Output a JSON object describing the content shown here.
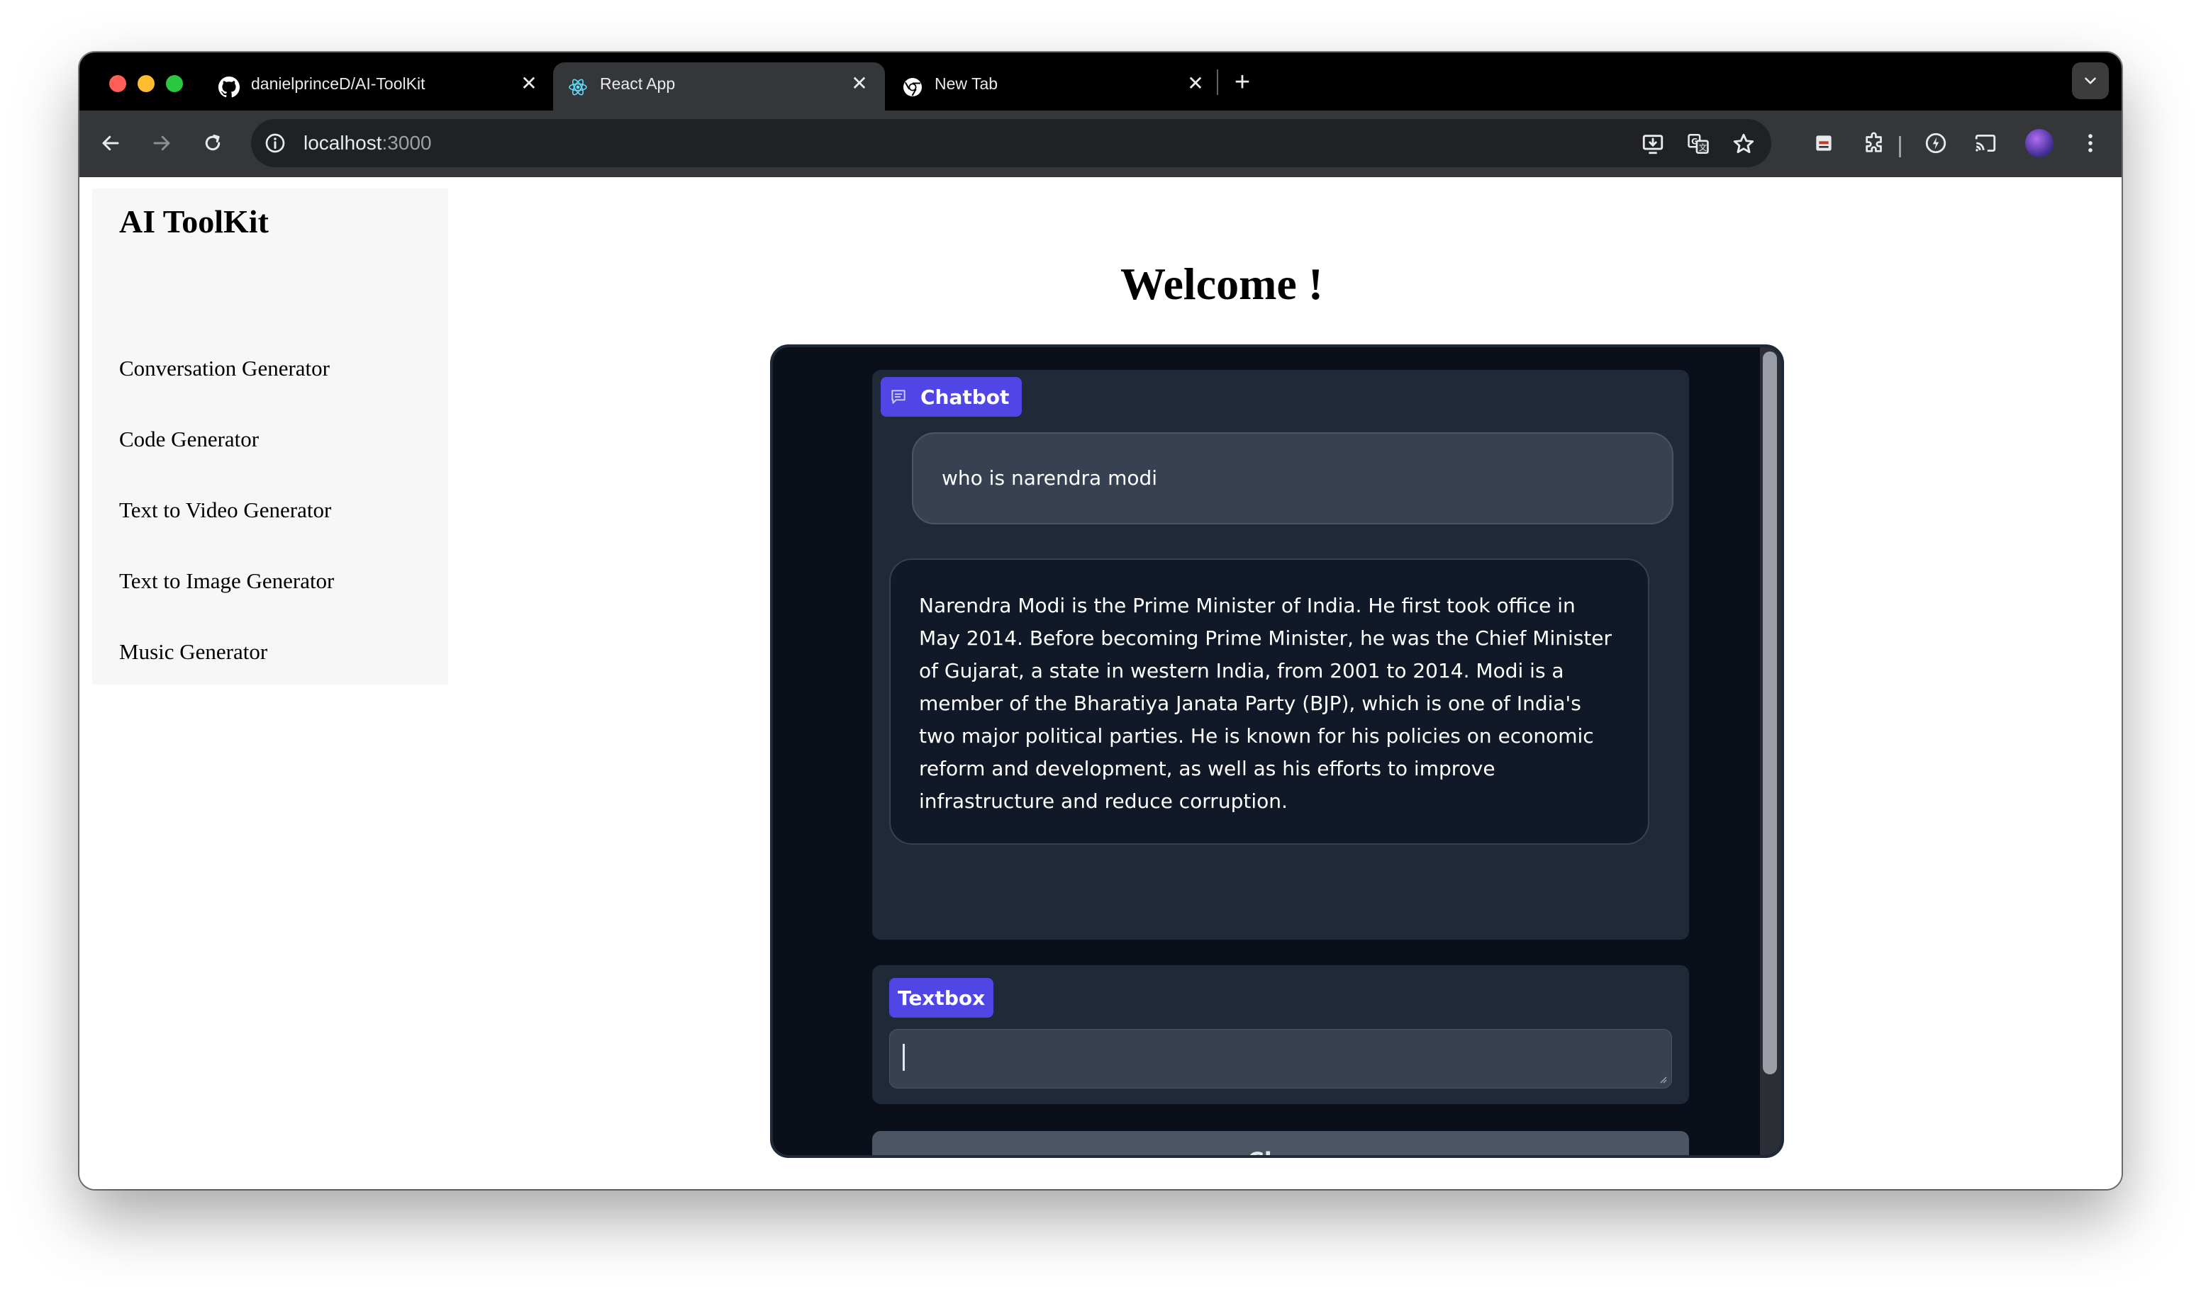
{
  "browser": {
    "tabs": [
      {
        "title": "danielprinceD/AI-ToolKit",
        "favicon": "github-icon",
        "active": false
      },
      {
        "title": "React App",
        "favicon": "react-icon",
        "active": true
      },
      {
        "title": "New Tab",
        "favicon": "chrome-icon",
        "active": false
      }
    ],
    "url_host": "localhost",
    "url_port": ":3000"
  },
  "sidebar": {
    "brand": "AI ToolKit",
    "items": [
      {
        "label": "Conversation Generator"
      },
      {
        "label": "Code Generator"
      },
      {
        "label": "Text to Video Generator"
      },
      {
        "label": "Text to Image Generator"
      },
      {
        "label": "Music Generator"
      }
    ]
  },
  "main": {
    "heading": "Welcome !"
  },
  "chatbot": {
    "label": "Chatbot",
    "messages": [
      {
        "role": "user",
        "text": "who is narendra modi"
      },
      {
        "role": "bot",
        "text": "Narendra Modi is the Prime Minister of India. He first took office in May 2014. Before becoming Prime Minister, he was the Chief Minister of Gujarat, a state in western India, from 2001 to 2014. Modi is a member of the Bharatiya Janata Party (BJP), which is one of India's two major political parties. He is known for his policies on economic reform and development, as well as his efforts to improve infrastructure and reduce corruption."
      }
    ]
  },
  "textbox": {
    "label": "Textbox",
    "value": ""
  },
  "clear_button": {
    "label": "Clear"
  },
  "colors": {
    "accent": "#4f46e5",
    "app_background": "#0b0f19",
    "block_background": "#1f2937"
  }
}
